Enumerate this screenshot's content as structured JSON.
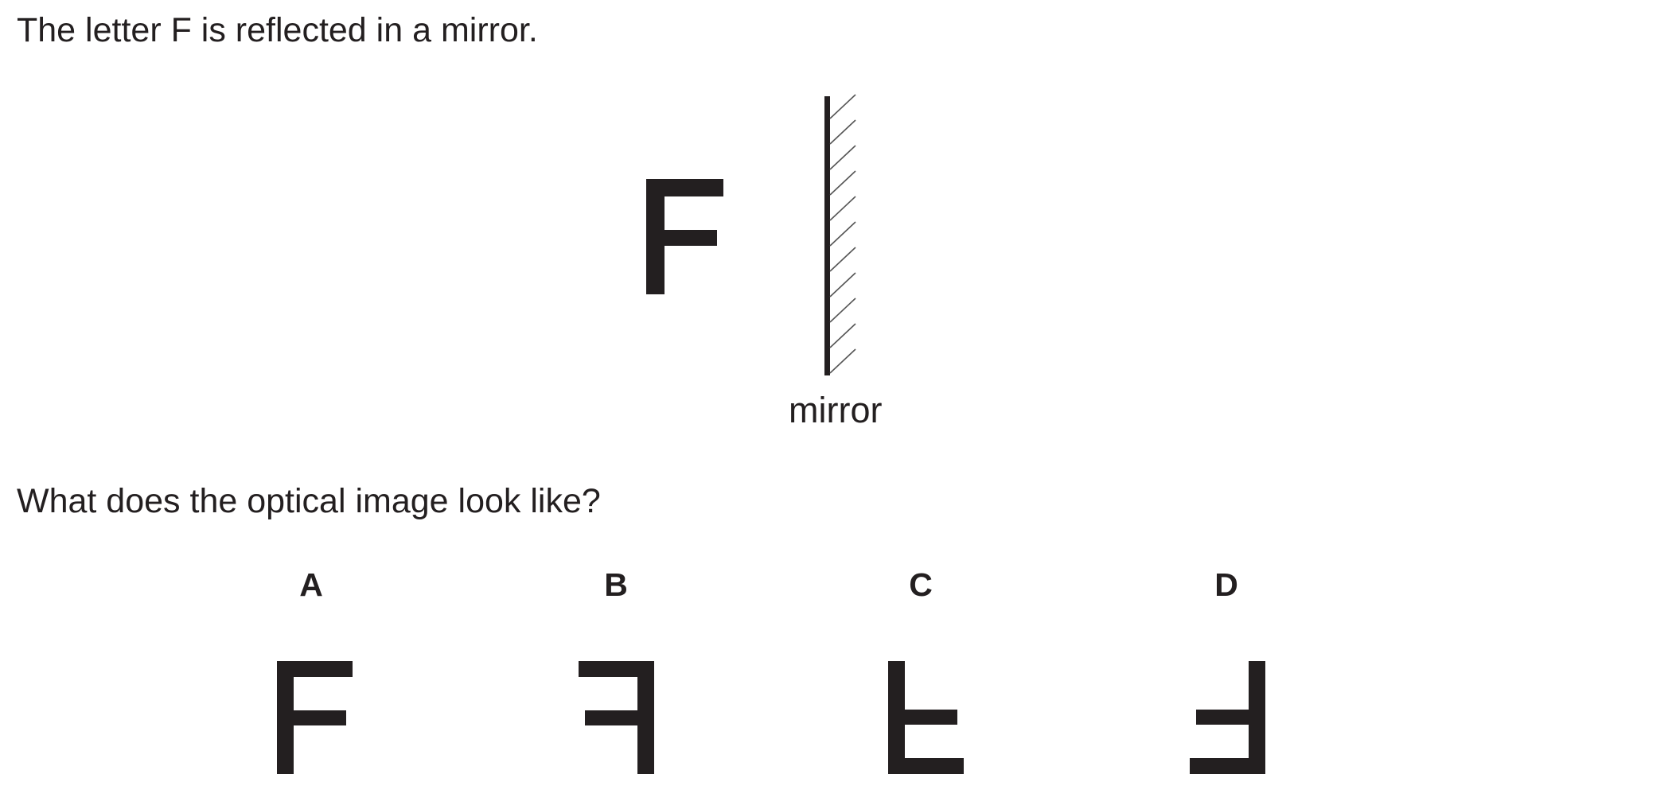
{
  "intro_text": "The letter F is reflected in a mirror.",
  "question_text": "What does the optical image look like?",
  "mirror_label": "mirror",
  "options": [
    {
      "label": "A",
      "orientation": "normal"
    },
    {
      "label": "B",
      "orientation": "mirrored-horizontal"
    },
    {
      "label": "C",
      "orientation": "flipped-vertical"
    },
    {
      "label": "D",
      "orientation": "rotated-180"
    }
  ],
  "colors": {
    "ink": "#231f20",
    "hatch": "#555555"
  }
}
